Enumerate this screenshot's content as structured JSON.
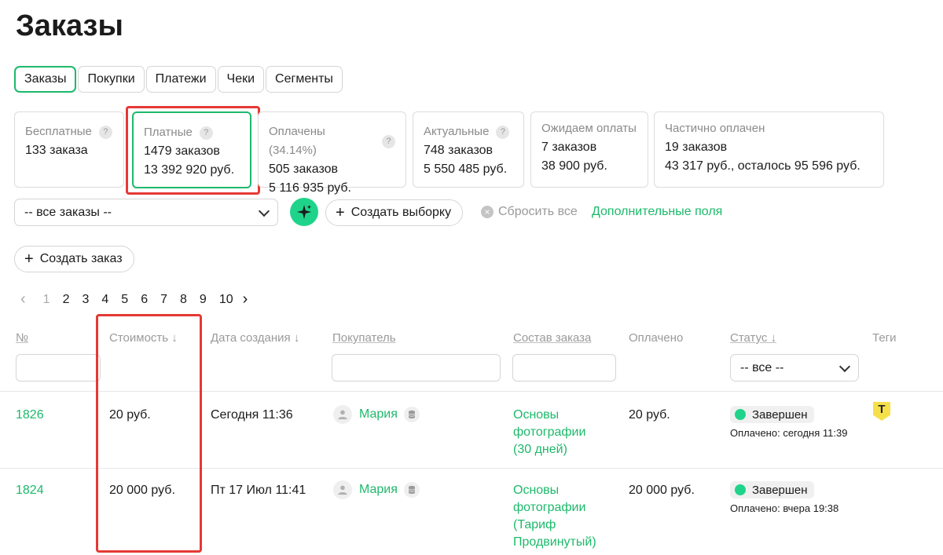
{
  "page": {
    "title": "Заказы"
  },
  "tabs": [
    {
      "label": "Заказы",
      "active": true
    },
    {
      "label": "Покупки"
    },
    {
      "label": "Платежи"
    },
    {
      "label": "Чеки"
    },
    {
      "label": "Сегменты"
    }
  ],
  "stats": [
    {
      "label": "Бесплатные",
      "help": "?",
      "line1": "133 заказа",
      "line2": ""
    },
    {
      "label": "Платные",
      "help": "?",
      "line1": "1479 заказов",
      "line2": "13 392 920 руб."
    },
    {
      "label": "Оплачены (34.14%)",
      "help": "?",
      "line1": "505 заказов",
      "line2": "5 116 935 руб."
    },
    {
      "label": "Актуальные",
      "help": "?",
      "line1": "748 заказов",
      "line2": "5 550 485 руб."
    },
    {
      "label": "Ожидаем оплаты",
      "line1": "7 заказов",
      "line2": "38 900 руб."
    },
    {
      "label": "Частично оплачен",
      "line1": "19 заказов",
      "line2": "43 317 руб., осталось 95 596 руб."
    }
  ],
  "filters": {
    "orders_select": "-- все заказы --",
    "create_selection": "Создать выборку",
    "reset_all": "Сбросить все",
    "extra_fields": "Дополнительные поля",
    "create_order": "Создать заказ"
  },
  "pagination": {
    "prev": "‹",
    "pages": [
      "1",
      "2",
      "3",
      "4",
      "5",
      "6",
      "7",
      "8",
      "9",
      "10"
    ],
    "next": "›"
  },
  "table": {
    "headers": {
      "num": "№",
      "cost": "Стоимость ↓",
      "created": "Дата создания ↓",
      "buyer": "Покупатель",
      "composition": "Состав заказа",
      "paid": "Оплачено",
      "status": "Статус ↓",
      "tags": "Теги"
    },
    "status_filter": "-- все --",
    "rows": [
      {
        "id": "1826",
        "cost": "20 руб.",
        "created": "Сегодня 11:36",
        "buyer": "Мария",
        "composition": [
          "Основы",
          "фотографии",
          "(30 дней)"
        ],
        "paid": "20 руб.",
        "status": "Завершен",
        "paid_note": "Оплачено: сегодня 11:39",
        "tag": "T"
      },
      {
        "id": "1824",
        "cost": "20 000 руб.",
        "created": "Пт 17 Июл 11:41",
        "buyer": "Мария",
        "composition": [
          "Основы",
          "фотографии",
          "(Тариф",
          "Продвинутый)"
        ],
        "paid": "20 000 руб.",
        "status": "Завершен",
        "paid_note": "Оплачено: вчера 19:38"
      }
    ]
  }
}
